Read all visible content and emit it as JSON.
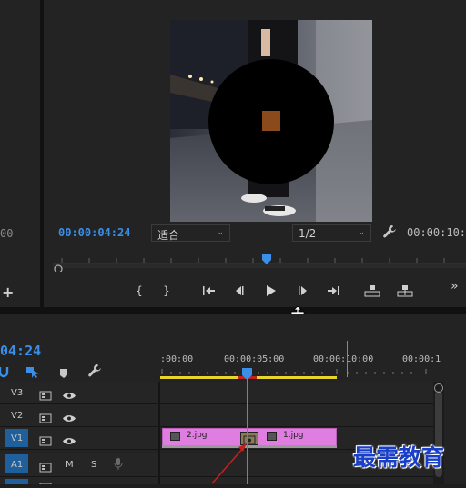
{
  "program_monitor": {
    "timecode_current": "00:00:04:24",
    "left_clip_partial": "00",
    "fit_label": "适合",
    "resolution_label": "1/2",
    "timecode_duration": "00:00:10:0",
    "playback_controls": [
      "{",
      "}",
      "⇤",
      "◂|",
      "▶",
      "|▸",
      "⇥",
      "lift",
      "extract",
      "»"
    ]
  },
  "timeline": {
    "timecode": "04:24",
    "ruler_labels": [
      ":00:00",
      "00:00:05:00",
      "00:00:10:00",
      "00:00:1"
    ],
    "tracks": [
      {
        "name": "V3",
        "type": "video"
      },
      {
        "name": "V2",
        "type": "video"
      },
      {
        "name": "V1",
        "type": "video"
      },
      {
        "name": "A1",
        "type": "audio",
        "m": "M",
        "s": "S"
      }
    ],
    "clips": [
      {
        "label": "2.jpg",
        "color": "#e07de0"
      },
      {
        "label": "1.jpg",
        "color": "#e07de0"
      }
    ]
  },
  "watermark": "最需教育",
  "colors": {
    "accent_blue": "#3a8fe8",
    "clip_pink": "#e07de0",
    "work_area_yellow": "#e8d42a",
    "arrow_red": "#c0211f"
  }
}
